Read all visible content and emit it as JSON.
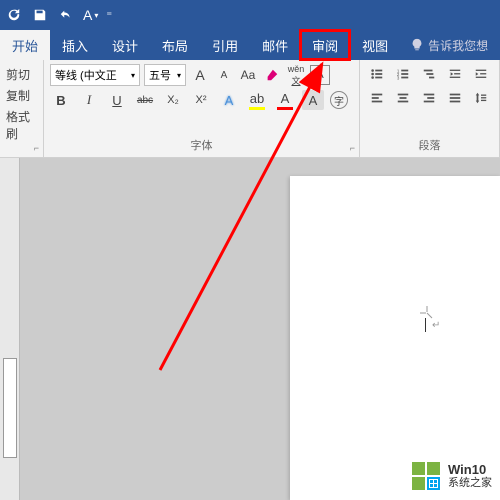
{
  "titlebar": {
    "font_letter": "A"
  },
  "tabs": {
    "home": "开始",
    "insert": "插入",
    "design": "设计",
    "layout": "布局",
    "references": "引用",
    "mailings": "邮件",
    "review": "审阅",
    "view": "视图",
    "tell_me": "告诉我您想"
  },
  "clipboard": {
    "cut": "剪切",
    "copy": "复制",
    "format_painter": "格式刷"
  },
  "font": {
    "name": "等线 (中文正",
    "size": "五号",
    "grow": "A",
    "shrink": "A",
    "case": "Aa",
    "phonetic": "wěn",
    "clear": "A",
    "bold": "B",
    "italic": "I",
    "underline": "U",
    "strike": "abc",
    "sub": "X₂",
    "sup": "X²",
    "text_effect": "A",
    "highlight": "ab",
    "font_color": "A",
    "char_shading": "A",
    "group_label": "字体"
  },
  "para": {
    "group_label": "段落"
  },
  "watermark": {
    "title": "Win10",
    "subtitle": "系统之家"
  }
}
